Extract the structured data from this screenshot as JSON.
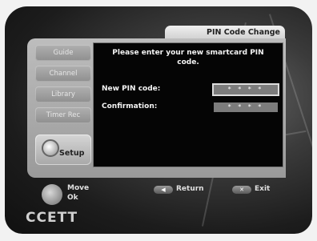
{
  "dialog": {
    "title": "PIN Code Change",
    "message_line1": "Please enter your new smartcard PIN",
    "message_line2": "code.",
    "new_pin_label": "New PIN code:",
    "new_pin_value": "* * * *",
    "confirmation_label": "Confirmation:",
    "confirmation_value": "* * * *"
  },
  "menu": {
    "items": [
      {
        "label": "Guide"
      },
      {
        "label": "Channel"
      },
      {
        "label": "Library"
      },
      {
        "label": "Timer Rec"
      }
    ],
    "setup_label": "Setup"
  },
  "footer": {
    "move_label": "Move",
    "ok_label": "Ok",
    "return_label": "Return",
    "exit_label": "Exit",
    "brand": "CCETT"
  }
}
